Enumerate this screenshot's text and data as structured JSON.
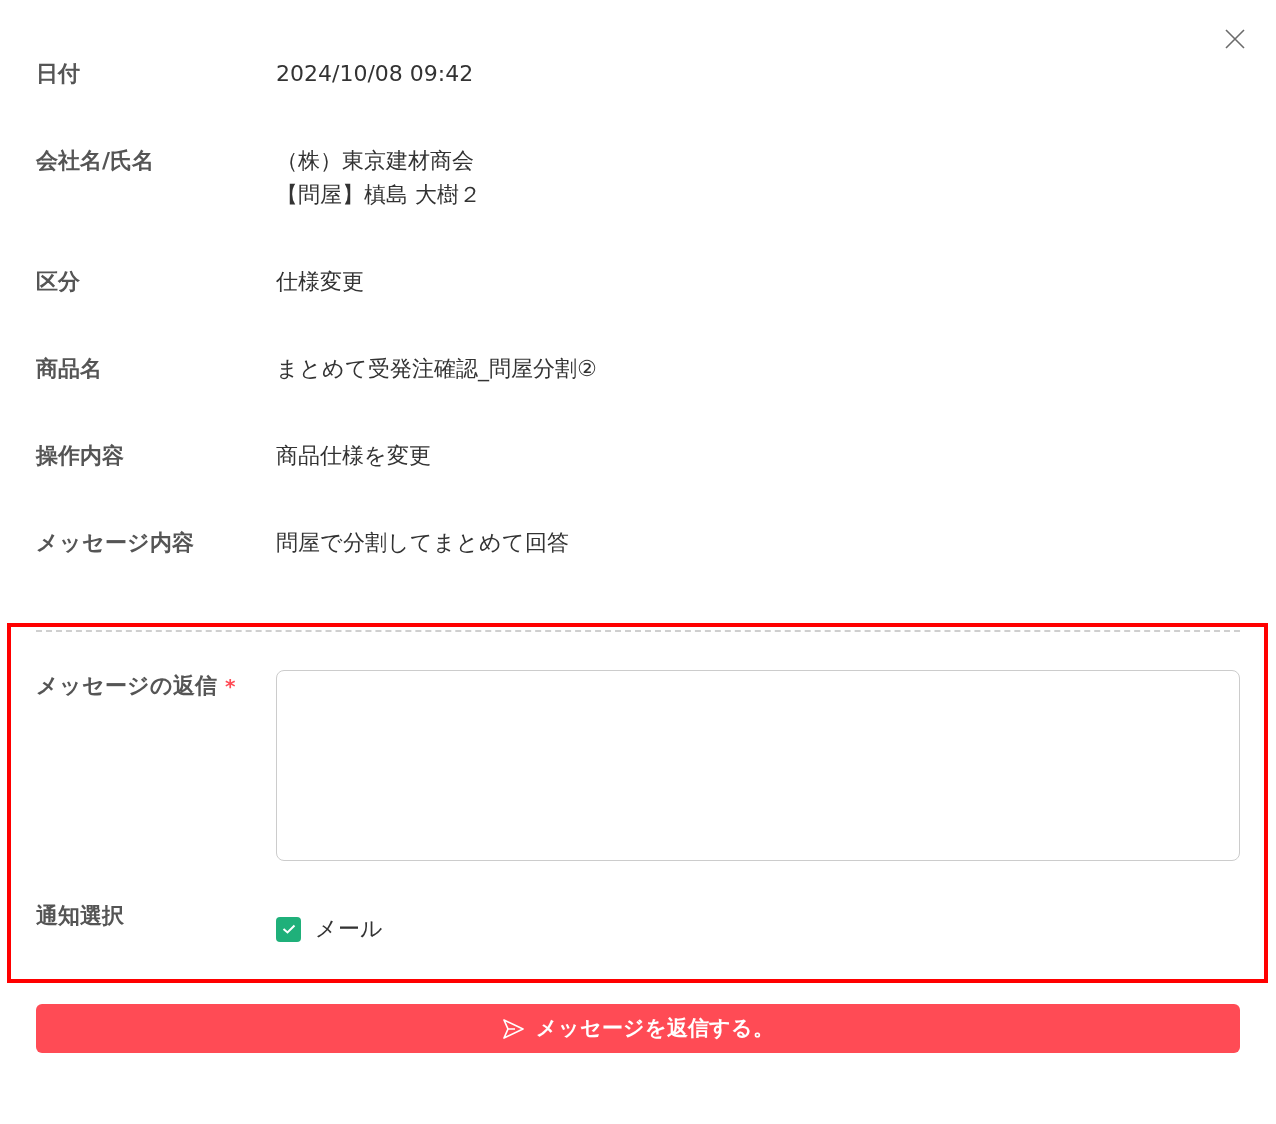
{
  "details": [
    {
      "label": "日付",
      "lines": [
        "2024/10/08 09:42"
      ]
    },
    {
      "label": "会社名/氏名",
      "lines": [
        "（株）東京建材商会",
        "【問屋】槙島 大樹２"
      ]
    },
    {
      "label": "区分",
      "lines": [
        "仕様変更"
      ]
    },
    {
      "label": "商品名",
      "lines": [
        "まとめて受発注確認_問屋分割②"
      ]
    },
    {
      "label": "操作内容",
      "lines": [
        "商品仕様を変更"
      ]
    },
    {
      "label": "メッセージ内容",
      "lines": [
        "問屋で分割してまとめて回答"
      ]
    }
  ],
  "reply": {
    "label": "メッセージの返信",
    "required_mark": "*"
  },
  "notification": {
    "label": "通知選択",
    "options": [
      {
        "label": "メール",
        "checked": true
      }
    ]
  },
  "submit_button": {
    "label": "メッセージを返信する。"
  }
}
